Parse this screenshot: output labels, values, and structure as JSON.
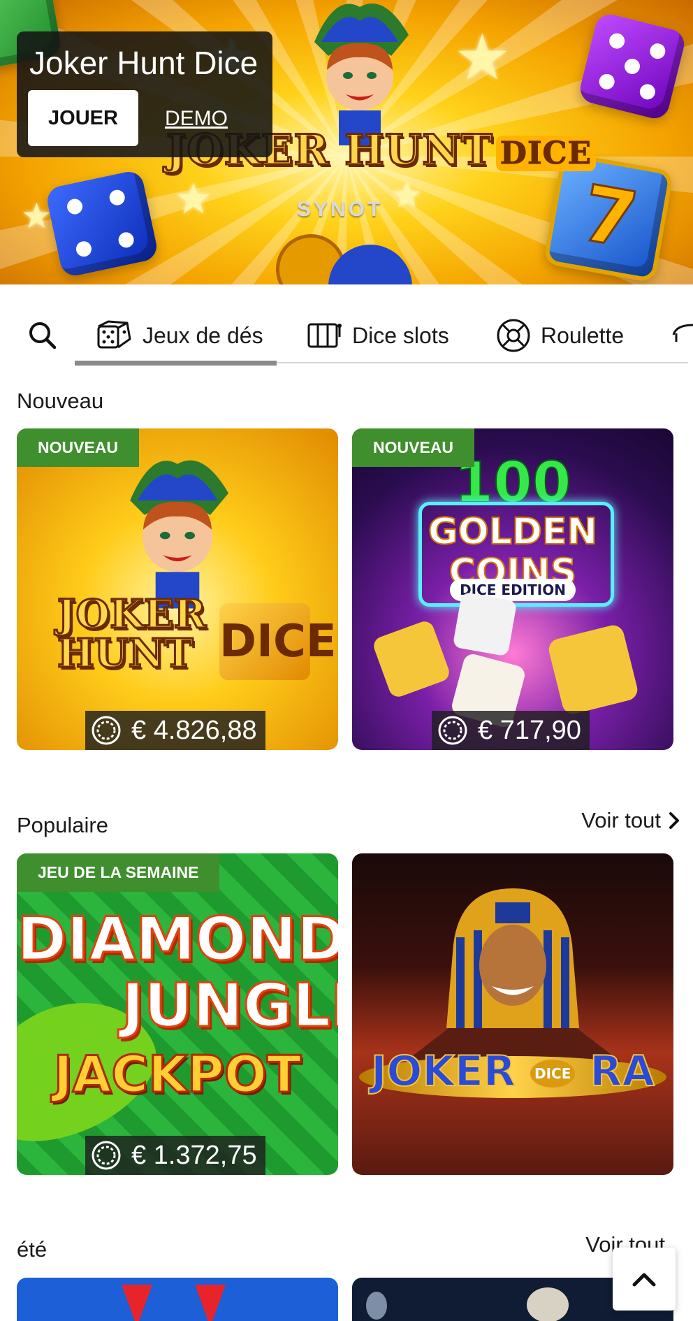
{
  "hero": {
    "title": "Joker Hunt Dice",
    "play_label": "JOUER",
    "demo_label": "DEMO",
    "logo_text": "JOKER HUNT",
    "logo_badge": "DICE",
    "maker": "SYNOT"
  },
  "tabs": {
    "search_icon": "search-icon",
    "items": [
      {
        "label": "Jeux de dés",
        "icon": "dice-icon",
        "active": true
      },
      {
        "label": "Dice slots",
        "icon": "slot-machine-icon",
        "active": false
      },
      {
        "label": "Roulette",
        "icon": "roulette-icon",
        "active": false
      }
    ]
  },
  "sections": [
    {
      "title": "Nouveau",
      "games": [
        {
          "badge": "NOUVEAU",
          "jackpot": "€ 4.826,88",
          "art": [
            "JOKER",
            "HUNT",
            "DICE"
          ]
        },
        {
          "badge": "NOUVEAU",
          "jackpot": "€ 717,90",
          "art": [
            "100",
            "GOLDEN",
            "COINS",
            "DICE EDITION"
          ]
        }
      ]
    },
    {
      "title": "Populaire",
      "see_all": "Voir tout",
      "games": [
        {
          "badge": "JEU DE LA SEMAINE",
          "jackpot": "€ 1.372,75",
          "art": [
            "DIAMOND",
            "JUNGLE",
            "JACKPOT"
          ]
        },
        {
          "art": [
            "JOKER",
            "RA",
            "DICE"
          ]
        }
      ]
    },
    {
      "title": "été",
      "see_all": "Voir tout"
    }
  ],
  "colors": {
    "badge_green": "#3f8f2e",
    "dark_overlay": "#141414",
    "tab_indicator": "#8a8a8a"
  }
}
